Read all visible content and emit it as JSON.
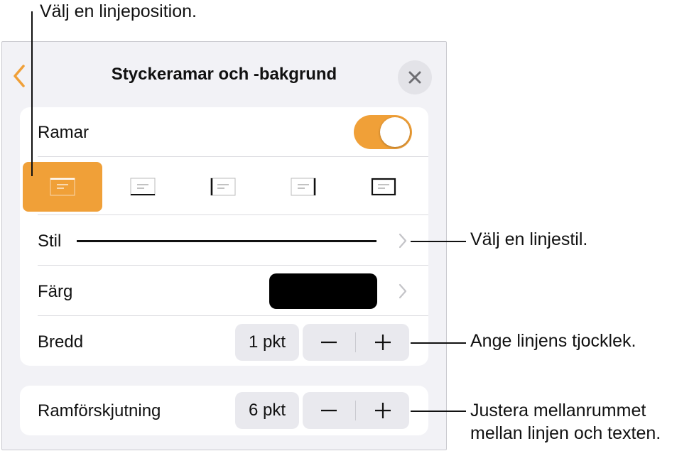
{
  "callouts": {
    "position": "Välj en linjeposition.",
    "style": "Välj en linjestil.",
    "width": "Ange linjens tjocklek.",
    "offset_line1": "Justera mellanrummet",
    "offset_line2": "mellan linjen och texten."
  },
  "panel": {
    "title": "Styckeramar och -bakgrund",
    "borders": {
      "label": "Ramar",
      "enabled": true,
      "positions": [
        {
          "name": "top",
          "selected": true
        },
        {
          "name": "bottom",
          "selected": false
        },
        {
          "name": "left",
          "selected": false
        },
        {
          "name": "right",
          "selected": false
        },
        {
          "name": "all",
          "selected": false
        }
      ]
    },
    "style": {
      "label": "Stil"
    },
    "color": {
      "label": "Färg",
      "value": "#000000"
    },
    "width": {
      "label": "Bredd",
      "value": "1 pkt"
    },
    "offset": {
      "label": "Ramförskjutning",
      "value": "6 pkt"
    }
  },
  "colors": {
    "accent": "#f0a038",
    "panel_bg": "#f2f2f6"
  },
  "icons": [
    "chevron-left-icon",
    "close-icon",
    "chevron-right-icon",
    "minus-icon",
    "plus-icon"
  ]
}
